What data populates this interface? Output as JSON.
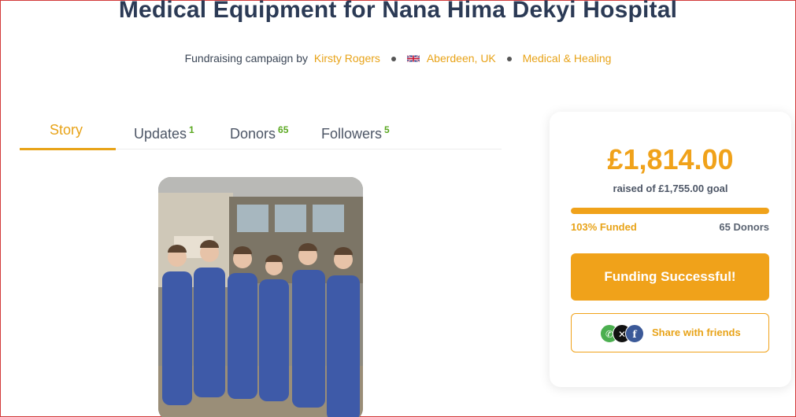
{
  "campaign": {
    "title": "Medical Equipment for Nana Hima Dekyi Hospital",
    "meta_prefix": "Fundraising campaign by",
    "organizer": "Kirsty Rogers",
    "location": "Aberdeen, UK",
    "category": "Medical & Healing",
    "location_flag": "uk-flag-icon"
  },
  "tabs": [
    {
      "label": "Story",
      "count": ""
    },
    {
      "label": "Updates",
      "count": "1"
    },
    {
      "label": "Donors",
      "count": "65"
    },
    {
      "label": "Followers",
      "count": "5"
    }
  ],
  "photo": {
    "description_icon": "campaign-photo"
  },
  "card": {
    "raised": "£1,814.00",
    "goal_text": "raised of £1,755.00 goal",
    "funded_text": "103% Funded",
    "funded_fraction": 1.0,
    "donors_text": "65 Donors",
    "status_button": "Funding Successful!",
    "share_label": "Share with friends",
    "share_icons": [
      "whatsapp-icon",
      "x-icon",
      "facebook-icon"
    ]
  },
  "colors": {
    "accent": "#f0a21a",
    "title": "#2b3a55",
    "count_green": "#5aa820"
  }
}
